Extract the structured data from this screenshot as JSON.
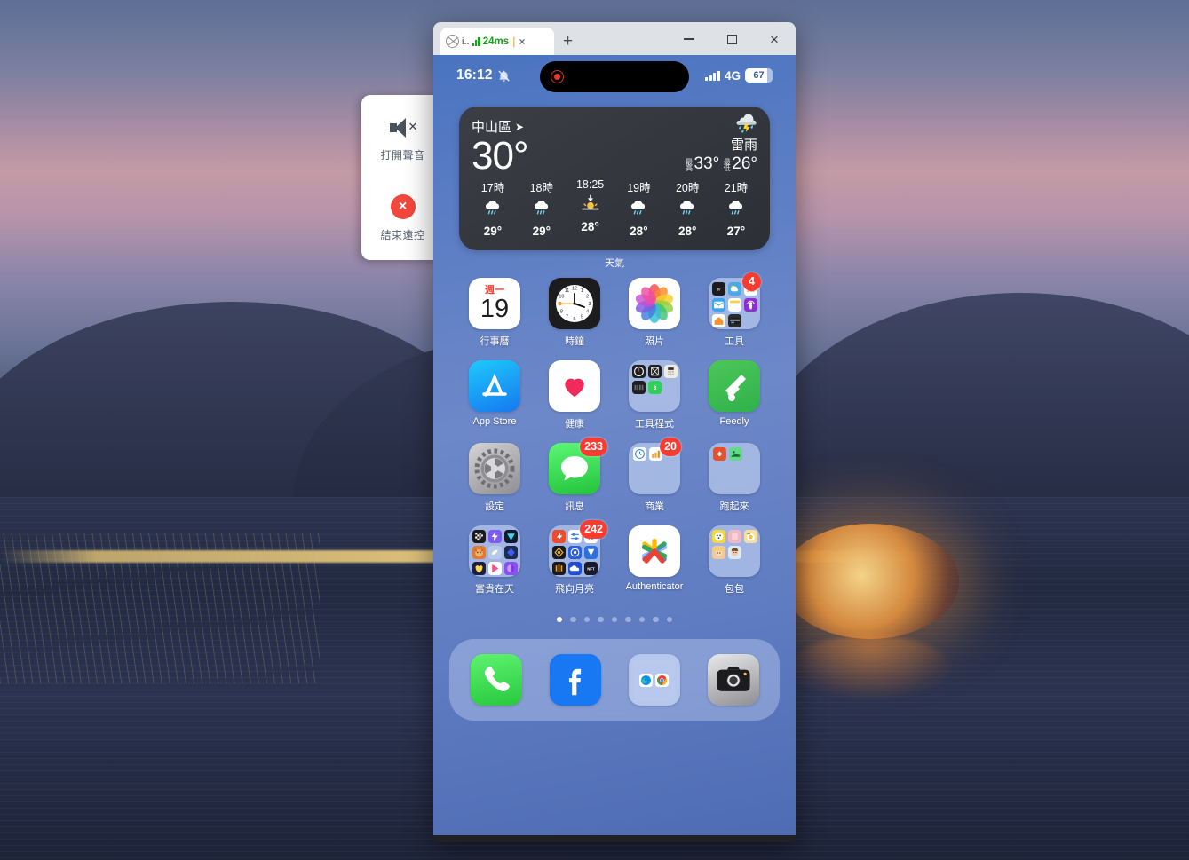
{
  "browser": {
    "tab": {
      "favicon": "globe-wire-icon",
      "title": "i..",
      "signal_icon": "signal-bars-icon",
      "latency": "24ms",
      "separator": "|",
      "close": "×"
    },
    "new_tab": "+",
    "controls": {
      "minimize": "minimize-icon",
      "maximize": "maximize-icon",
      "close": "×"
    }
  },
  "remote_panel": {
    "mute_icon": "speaker-mute-icon",
    "mute_label": "打開聲音",
    "end_icon": "×",
    "end_label": "結束遠控"
  },
  "status_bar": {
    "time": "16:12",
    "bell_icon": "bell-slash-icon",
    "recording_icon": "recording-dot-icon",
    "signal_icon": "cellular-bars-icon",
    "network": "4G",
    "battery_percent": "67",
    "battery_fill": 82
  },
  "weather": {
    "location": "中山區",
    "location_arrow": "➤",
    "current_temp": "30°",
    "condition_icon": "thunderstorm-icon",
    "condition": "雷雨",
    "high_label": "最高",
    "high": "33°",
    "low_label": "最低",
    "low": "26°",
    "widget_label": "天氣",
    "hours": [
      {
        "time": "17時",
        "icon": "rain-icon",
        "temp": "29°"
      },
      {
        "time": "18時",
        "icon": "rain-icon",
        "temp": "29°"
      },
      {
        "time": "18:25",
        "icon": "sunset-icon",
        "temp": "28°"
      },
      {
        "time": "19時",
        "icon": "rain-icon",
        "temp": "28°"
      },
      {
        "time": "20時",
        "icon": "rain-icon",
        "temp": "28°"
      },
      {
        "time": "21時",
        "icon": "rain-icon",
        "temp": "27°"
      }
    ]
  },
  "home": {
    "calendar": {
      "dow": "週一",
      "day": "19"
    },
    "apps": [
      {
        "name": "行事曆",
        "icon": "calendar-icon",
        "badge": null
      },
      {
        "name": "時鐘",
        "icon": "clock-icon",
        "badge": null
      },
      {
        "name": "照片",
        "icon": "photos-icon",
        "badge": null
      },
      {
        "name": "工具",
        "icon": "folder-icon",
        "badge": "4"
      },
      {
        "name": "App Store",
        "icon": "appstore-icon",
        "badge": null
      },
      {
        "name": "健康",
        "icon": "health-icon",
        "badge": null
      },
      {
        "name": "工具程式",
        "icon": "folder-icon",
        "badge": null
      },
      {
        "name": "Feedly",
        "icon": "feedly-icon",
        "badge": null
      },
      {
        "name": "設定",
        "icon": "settings-icon",
        "badge": null
      },
      {
        "name": "訊息",
        "icon": "messages-icon",
        "badge": "233"
      },
      {
        "name": "商業",
        "icon": "folder-icon",
        "badge": "20"
      },
      {
        "name": "跑起來",
        "icon": "folder-icon",
        "badge": null
      },
      {
        "name": "富貴在天",
        "icon": "folder-icon",
        "badge": null
      },
      {
        "name": "飛向月亮",
        "icon": "folder-icon",
        "badge": "242"
      },
      {
        "name": "Authenticator",
        "icon": "authenticator-icon",
        "badge": null
      },
      {
        "name": "包包",
        "icon": "folder-icon",
        "badge": null
      }
    ],
    "page_dots": {
      "count": 9,
      "active": 1
    },
    "dock": [
      {
        "name": "phone-icon"
      },
      {
        "name": "facebook-icon"
      },
      {
        "name": "browsers-folder-icon"
      },
      {
        "name": "camera-icon"
      }
    ]
  }
}
